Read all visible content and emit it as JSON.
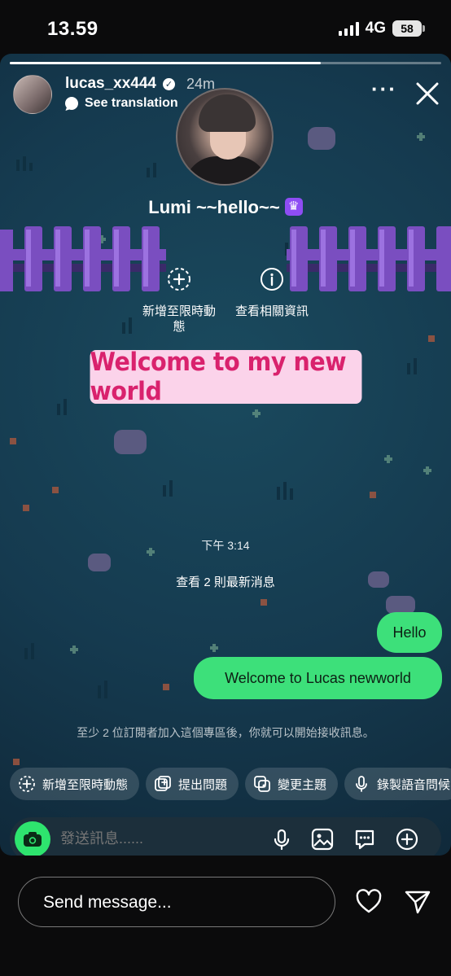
{
  "status_bar": {
    "time": "13.59",
    "network": "4G",
    "battery": "58"
  },
  "story": {
    "progress": 0.72,
    "username": "lucas_xx444",
    "time_ago": "24m",
    "see_translation": "See translation",
    "channel_name": "Lumi ~~hello~~",
    "actions": [
      {
        "label": "新增至限時動態",
        "icon": "plus-circle-icon"
      },
      {
        "label": "查看相關資訊",
        "icon": "info-circle-icon"
      }
    ],
    "sticker_text": "Welcome to my new world"
  },
  "chat": {
    "timestamp": "下午 3:14",
    "view_latest": "查看 2 則最新消息",
    "messages": [
      "Hello",
      "Welcome to Lucas newworld"
    ],
    "join_notice": "至少 2 位訂閱者加入這個專區後，你就可以開始接收訊息。",
    "chips": [
      {
        "label": "新增至限時動態",
        "icon": "plus-circle-icon"
      },
      {
        "label": "提出問題",
        "icon": "question-icon"
      },
      {
        "label": "變更主題",
        "icon": "theme-icon"
      },
      {
        "label": "錄製語音問候",
        "icon": "microphone-icon"
      }
    ],
    "composer_placeholder": "發送訊息......"
  },
  "bottom": {
    "send_placeholder": "Send message..."
  },
  "colors": {
    "accent_green": "#3de07a",
    "sticker_bg": "#fbd3ea",
    "sticker_text": "#d9226d",
    "crown_purple": "#8e4df4"
  }
}
